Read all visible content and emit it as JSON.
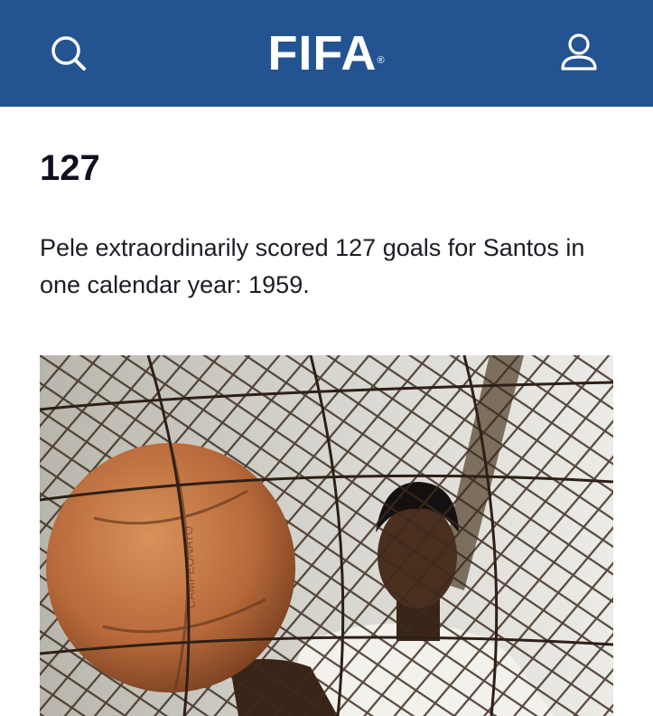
{
  "header": {
    "logo_text": "FIFA",
    "logo_mark": "®",
    "search_icon": "search-icon",
    "user_icon": "user-icon",
    "background": "#245392"
  },
  "article": {
    "stat": "127",
    "description": "Pele extraordinarily scored 127 goals for Santos in one calendar year: 1959."
  },
  "photo": {
    "ball_text": "CAMPEONATO"
  }
}
